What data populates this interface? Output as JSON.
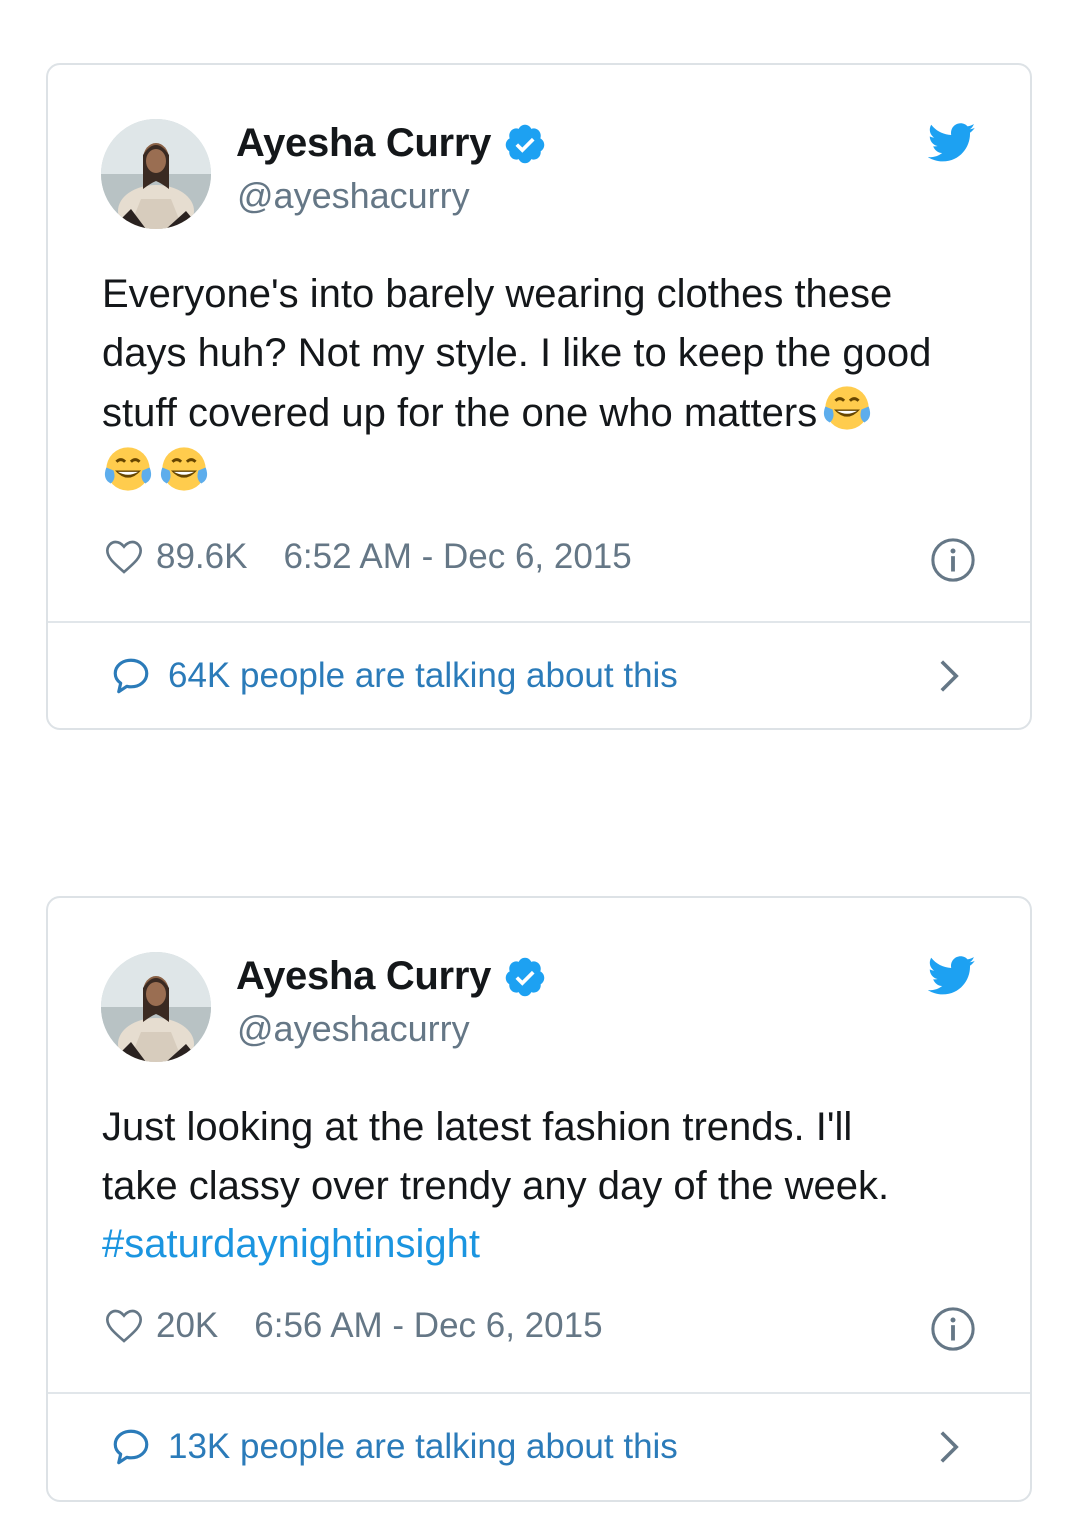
{
  "tweets": [
    {
      "author_name": "Ayesha Curry",
      "handle": "@ayeshacurry",
      "text_lines": [
        "Everyone's into barely wearing clothes these",
        "days huh? Not my style. I like to keep the good",
        "stuff covered up for the one who matters"
      ],
      "emojis": [
        "face-with-tears-of-joy",
        "face-with-tears-of-joy",
        "face-with-tears-of-joy"
      ],
      "likes": "89.6K",
      "timestamp": "6:52 AM - Dec 6, 2015",
      "talking": "64K people are talking about this"
    },
    {
      "author_name": "Ayesha Curry",
      "handle": "@ayeshacurry",
      "text_lines": [
        "Just looking at the latest fashion trends. I'll",
        "take classy over trendy any day of the week."
      ],
      "hashtag": "#saturdaynightinsight",
      "likes": "20K",
      "timestamp": "6:56 AM - Dec 6, 2015",
      "talking": "13K people are talking about this"
    }
  ],
  "colors": {
    "twitter_blue": "#1da1f2",
    "link_blue": "#2b7bb9",
    "hashtag_blue": "#1b95e0",
    "secondary_text": "#657786",
    "border": "#dde2e6"
  }
}
